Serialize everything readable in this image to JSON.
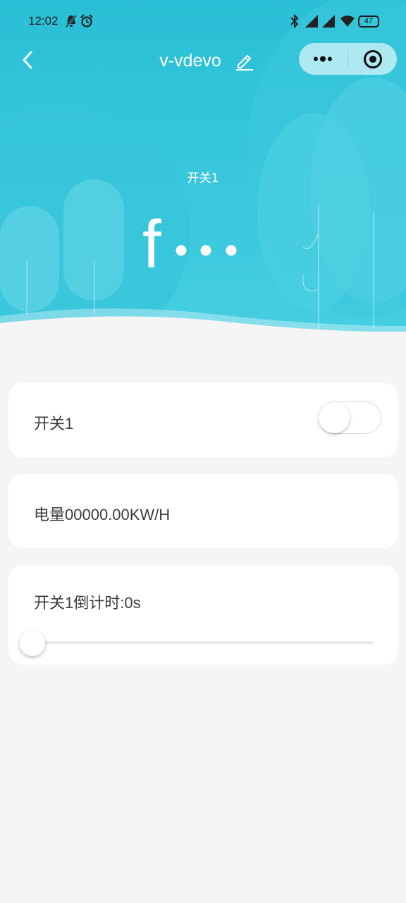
{
  "status_bar": {
    "time": "12:02",
    "battery": "47",
    "icons": [
      "notifications-muted-icon",
      "alarm-icon",
      "bluetooth-icon",
      "signal-icon",
      "signal-icon",
      "wifi-icon",
      "battery-icon"
    ]
  },
  "nav": {
    "title": "v-vdevo",
    "back_icon": "chevron-left-icon",
    "edit_icon": "pencil-icon",
    "capsule": {
      "more_icon": "more-icon",
      "close_icon": "target-close-icon"
    }
  },
  "hero": {
    "device_label": "开关1",
    "device_icon": "switch-glyph-icon",
    "colors": {
      "top": "#2cc0d6",
      "bottom": "#44cde0",
      "cloud": "#5cd4e4"
    }
  },
  "cards": {
    "switch1": {
      "label": "开关1",
      "toggle_on": false
    },
    "energy": {
      "label": "电量00000.00KW/H"
    },
    "countdown": {
      "label": "开关1倒计时:0s",
      "slider_value": 0
    }
  },
  "colors": {
    "accent": "#26c6da",
    "page_background": "#f5f5f5",
    "card_background": "#ffffff",
    "text": "#3c3c3c"
  }
}
